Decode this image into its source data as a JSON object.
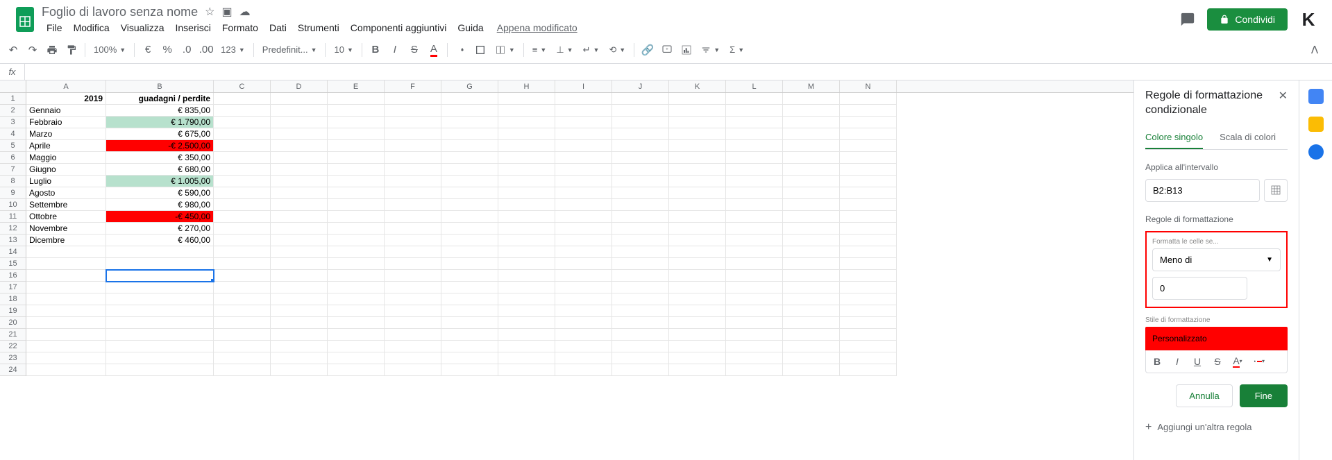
{
  "header": {
    "title": "Foglio di lavoro senza nome",
    "menus": [
      "File",
      "Modifica",
      "Visualizza",
      "Inserisci",
      "Formato",
      "Dati",
      "Strumenti",
      "Componenti aggiuntivi",
      "Guida"
    ],
    "last_modified": "Appena modificato",
    "share": "Condividi"
  },
  "toolbar": {
    "zoom": "100%",
    "font": "Predefinit...",
    "font_size": "10",
    "more_fmt": "123"
  },
  "sheet": {
    "columns": [
      "A",
      "B",
      "C",
      "D",
      "E",
      "F",
      "G",
      "H",
      "I",
      "J",
      "K",
      "L",
      "M",
      "N"
    ],
    "row_count": 24,
    "selected": {
      "row": 16,
      "col": "B"
    },
    "header_row": {
      "A": "2019",
      "B": "guadagni / perdite"
    },
    "data": [
      {
        "month": "Gennaio",
        "value": "€ 835,00",
        "hl": ""
      },
      {
        "month": "Febbraio",
        "value": "€ 1.790,00",
        "hl": "green"
      },
      {
        "month": "Marzo",
        "value": "€ 675,00",
        "hl": ""
      },
      {
        "month": "Aprile",
        "value": "-€ 2.500,00",
        "hl": "red"
      },
      {
        "month": "Maggio",
        "value": "€ 350,00",
        "hl": ""
      },
      {
        "month": "Giugno",
        "value": "€ 680,00",
        "hl": ""
      },
      {
        "month": "Luglio",
        "value": "€ 1.005,00",
        "hl": "green"
      },
      {
        "month": "Agosto",
        "value": "€ 590,00",
        "hl": ""
      },
      {
        "month": "Settembre",
        "value": "€ 980,00",
        "hl": ""
      },
      {
        "month": "Ottobre",
        "value": "-€ 450,00",
        "hl": "red"
      },
      {
        "month": "Novembre",
        "value": "€ 270,00",
        "hl": ""
      },
      {
        "month": "Dicembre",
        "value": "€ 460,00",
        "hl": ""
      }
    ]
  },
  "panel": {
    "title": "Regole di formattazione condizionale",
    "tab_single": "Colore singolo",
    "tab_scale": "Scala di colori",
    "apply_label": "Applica all'intervallo",
    "range": "B2:B13",
    "rules_label": "Regole di formattazione",
    "format_if": "Formatta le celle se...",
    "condition": "Meno di",
    "value": "0",
    "style_label": "Stile di formattazione",
    "style_preview": "Personalizzato",
    "cancel": "Annulla",
    "done": "Fine",
    "add_rule": "Aggiungi un'altra regola"
  }
}
